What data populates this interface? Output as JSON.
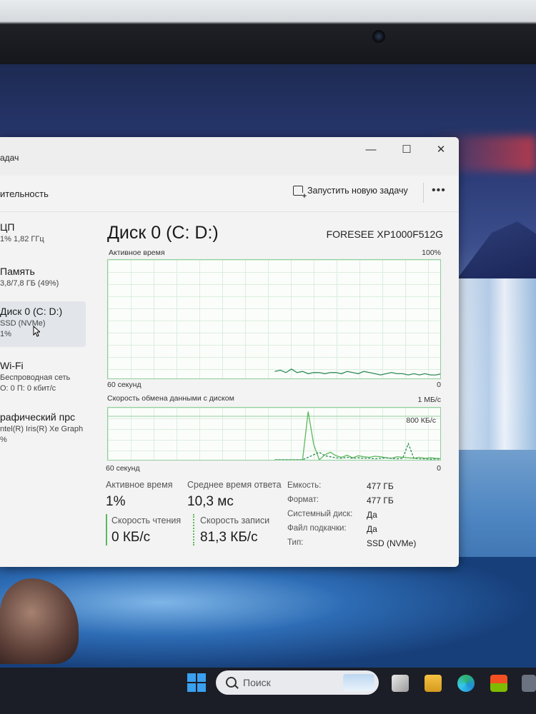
{
  "window": {
    "title": "адач",
    "controls": {
      "minimize": "—",
      "maximize": "☐",
      "close": "✕"
    }
  },
  "toolbar": {
    "section_title": "ительность",
    "run_new_task": "Запустить новую задачу",
    "more": "•••"
  },
  "sidebar": {
    "items": [
      {
        "name": "ЦП",
        "sub1": "1% 1,82 ГГц",
        "sub2": ""
      },
      {
        "name": "Память",
        "sub1": "3,8/7,8 ГБ (49%)",
        "sub2": ""
      },
      {
        "name": "Диск 0 (C: D:)",
        "sub1": "SSD (NVMe)",
        "sub2": "1%"
      },
      {
        "name": "Wi-Fi",
        "sub1": "Беспроводная сеть",
        "sub2": "О: 0 П: 0 кбит/с"
      },
      {
        "name": "рафический прс",
        "sub1": "ntel(R) Iris(R) Xe Graph",
        "sub2": "%"
      }
    ]
  },
  "main": {
    "title": "Диск 0 (C: D:)",
    "model": "FORESEE XP1000F512G",
    "graph1": {
      "label": "Активное время",
      "max": "100%",
      "time": "60 секунд",
      "min": "0"
    },
    "graph2": {
      "label": "Скорость обмена данными с диском",
      "max": "1 МБ/с",
      "mid": "800 КБ/с",
      "time": "60 секунд",
      "min": "0"
    },
    "stats": {
      "active_time_label": "Активное время",
      "active_time_value": "1%",
      "avg_response_label": "Среднее время ответа",
      "avg_response_value": "10,3 мс",
      "read_speed_label": "Скорость чтения",
      "read_speed_value": "0 КБ/с",
      "write_speed_label": "Скорость записи",
      "write_speed_value": "81,3 КБ/с"
    },
    "properties": [
      {
        "label": "Емкость:",
        "value": "477 ГБ"
      },
      {
        "label": "Формат:",
        "value": "477 ГБ"
      },
      {
        "label": "Системный диск:",
        "value": "Да"
      },
      {
        "label": "Файл подкачки:",
        "value": "Да"
      },
      {
        "label": "Тип:",
        "value": "SSD (NVMe)"
      }
    ]
  },
  "chart_data": [
    {
      "type": "area",
      "title": "Активное время",
      "ylim": [
        0,
        100
      ],
      "x": [
        0,
        2,
        4,
        6,
        8,
        10,
        12,
        14,
        16,
        18,
        20,
        22,
        24,
        26,
        28,
        30,
        32,
        34,
        36,
        38,
        40,
        42,
        44,
        46,
        48,
        50,
        52,
        54,
        56,
        58,
        60
      ],
      "series": [
        {
          "values": [
            0,
            0,
            0,
            0,
            0,
            0,
            0,
            0,
            0,
            0,
            0,
            0,
            0,
            0,
            0,
            0,
            0,
            0,
            0,
            0,
            0,
            0,
            0,
            0,
            0,
            0,
            0,
            0,
            0,
            0,
            0
          ]
        },
        {
          "values": [
            6,
            7,
            5,
            8,
            5,
            6,
            4,
            5,
            5,
            4,
            5,
            5,
            4,
            6,
            5,
            4,
            6,
            5,
            4,
            3,
            4,
            5,
            4,
            4,
            3,
            4,
            3,
            4,
            3,
            3,
            4
          ]
        }
      ]
    },
    {
      "type": "line",
      "title": "Скорость обмена данными с диском",
      "ylim": [
        0,
        1000
      ],
      "series": [
        {
          "values": [
            0,
            0,
            0,
            0,
            0,
            0,
            950,
            300,
            0,
            100,
            150,
            80,
            50,
            90,
            40,
            80,
            60,
            50,
            70,
            60,
            40,
            30,
            60,
            50,
            40,
            30,
            50,
            30,
            40,
            30,
            20
          ]
        },
        {
          "values": [
            0,
            0,
            0,
            0,
            0,
            0,
            50,
            100,
            150,
            80,
            60,
            40,
            30,
            50,
            30,
            40,
            30,
            30,
            20,
            30,
            40,
            30,
            20,
            30,
            320,
            30,
            20,
            20,
            10,
            20,
            10
          ]
        }
      ]
    }
  ],
  "taskbar": {
    "search_placeholder": "Поиск",
    "colors": {
      "accent": "#3aa0f0",
      "graph_line": "#2e8b57"
    }
  }
}
